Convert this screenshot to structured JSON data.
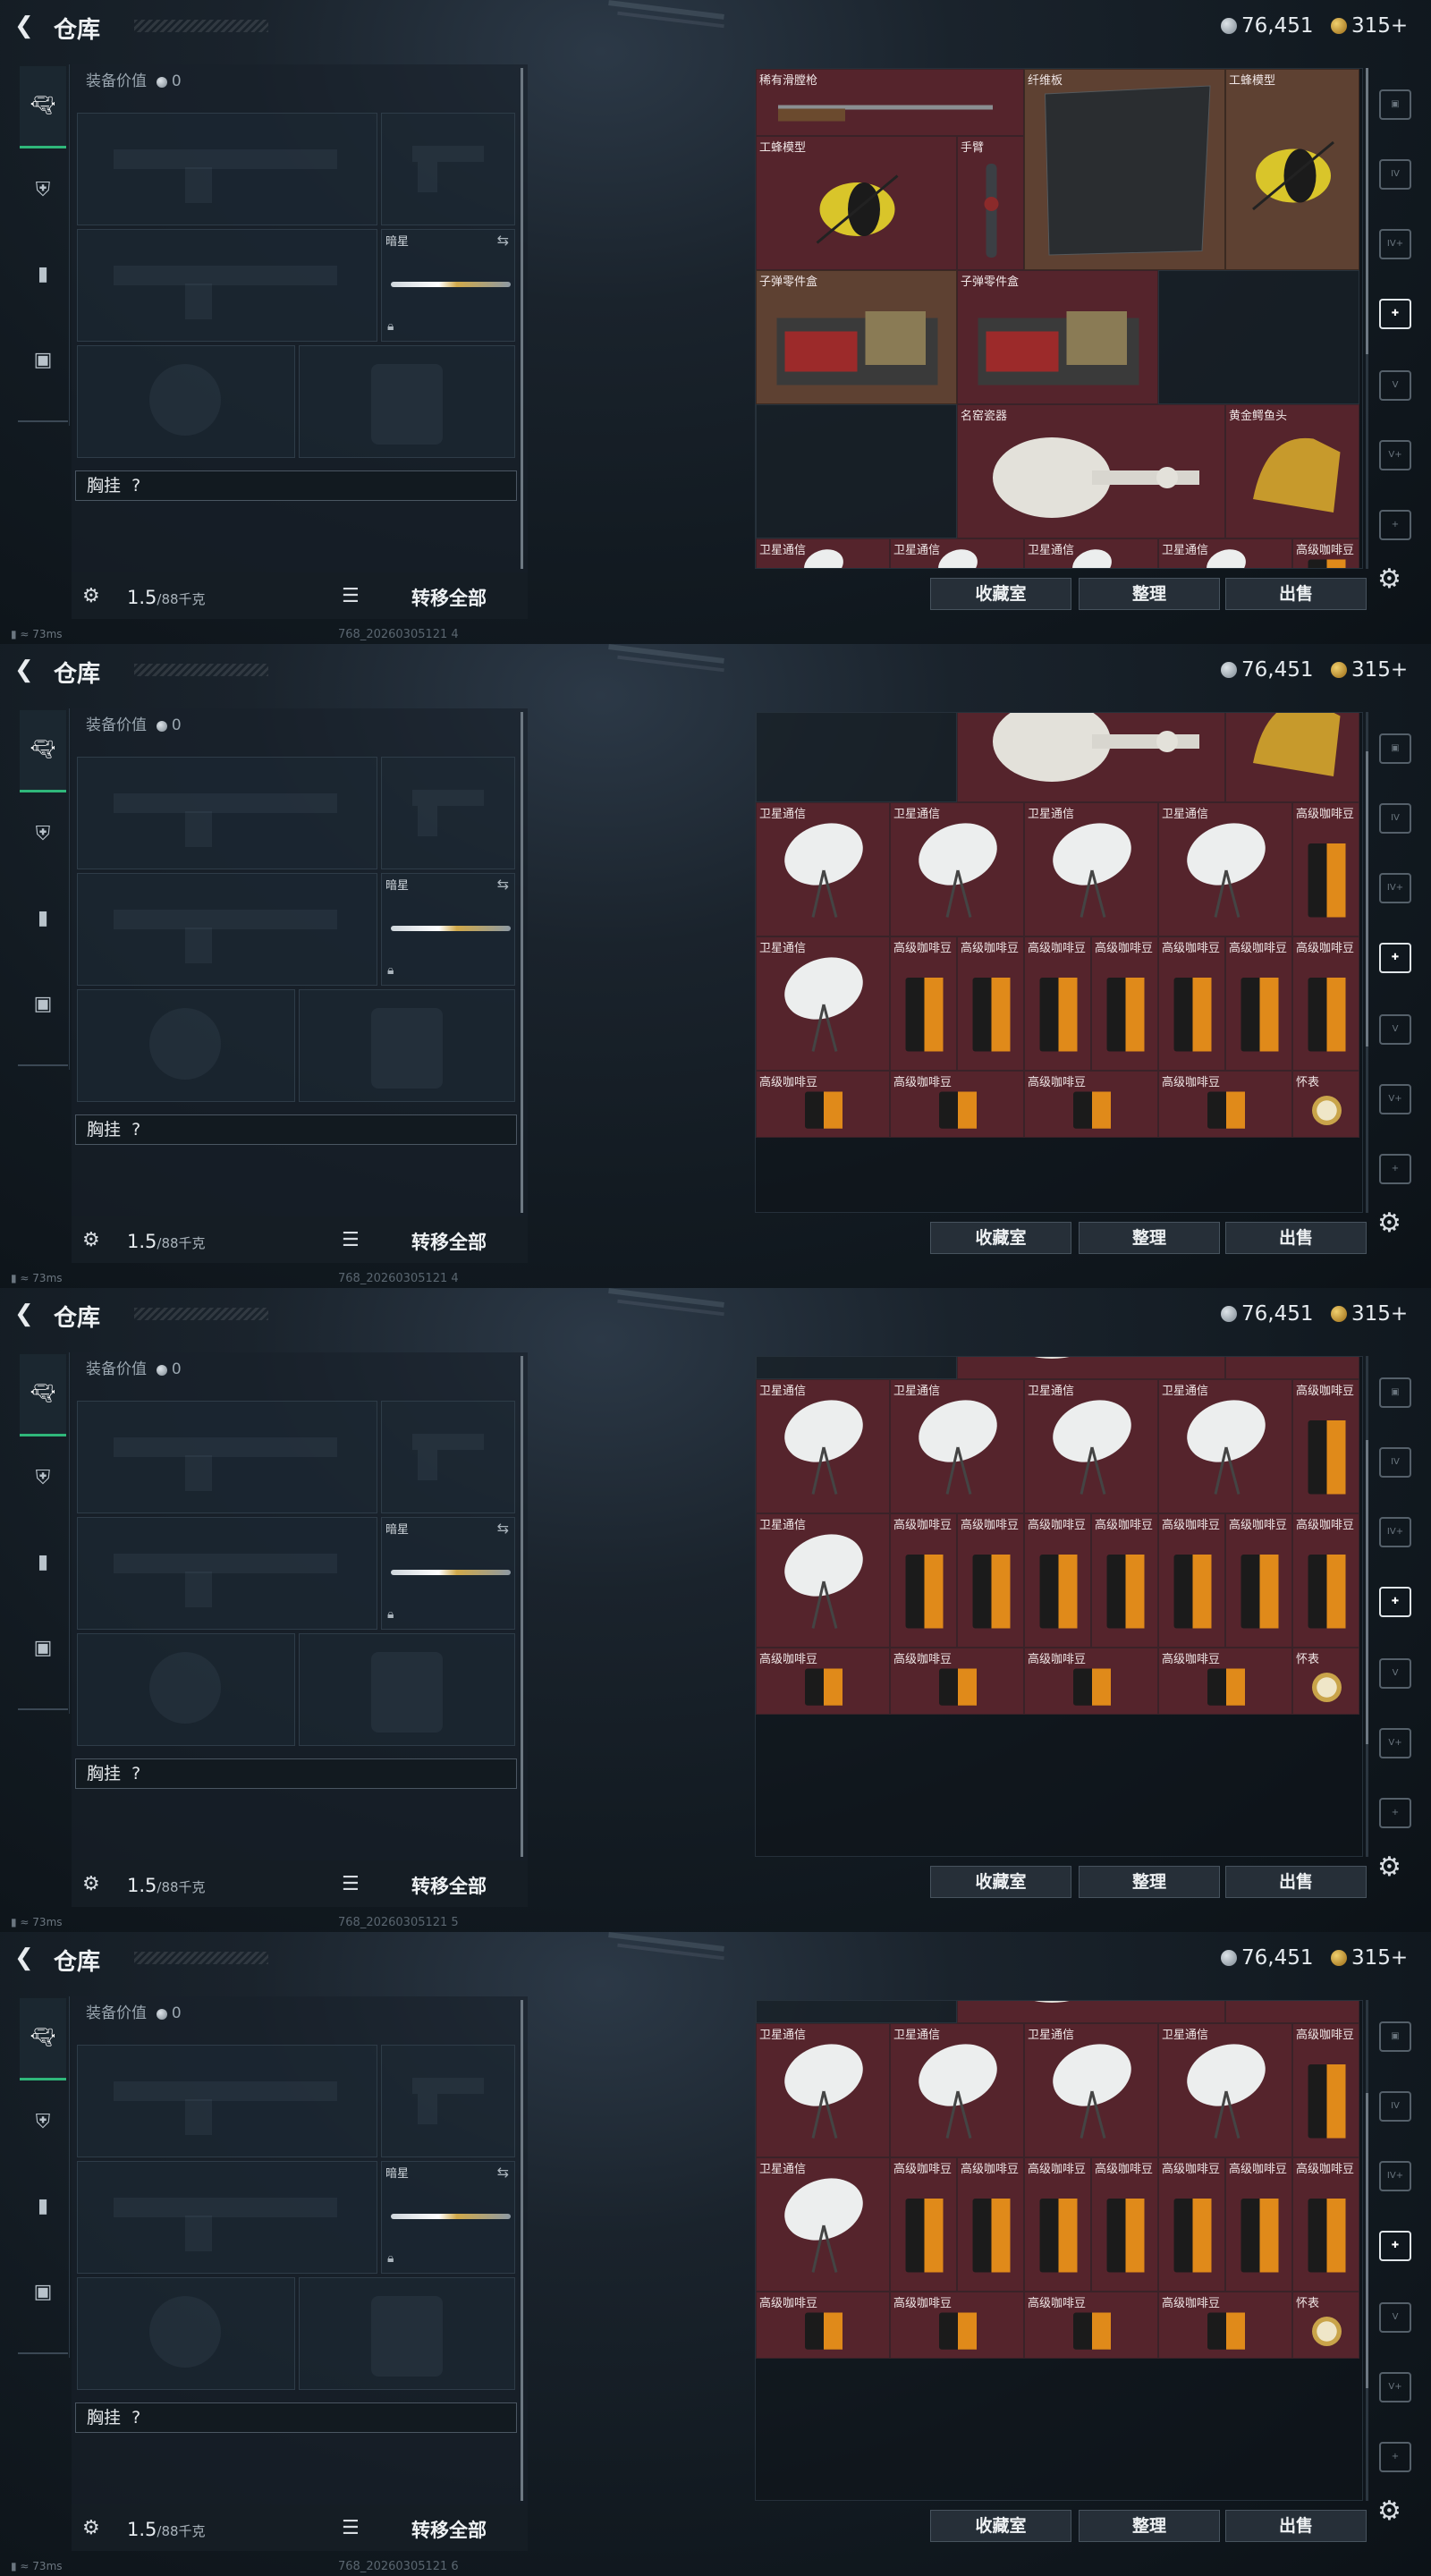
{
  "app": {
    "title": "仓库",
    "back_icon": "back-arrow-icon"
  },
  "currency": {
    "silver": "76,451",
    "gold": "315+",
    "silver_icon": "silver-coin-icon",
    "gold_icon": "gold-coin-icon"
  },
  "tabs": [
    {
      "icon": "pistol-icon",
      "active": true
    },
    {
      "icon": "helmet-icon",
      "active": false
    },
    {
      "icon": "backpack-icon",
      "active": false
    },
    {
      "icon": "case-icon",
      "active": false
    }
  ],
  "loadout": {
    "equipment_value_label": "装备价值",
    "equipment_value": "0",
    "melee_name": "暗星",
    "vest_label": "胸挂",
    "vest_value": "?",
    "weight": "1.5",
    "weight_capacity": "/88千克",
    "transfer_all": "转移全部"
  },
  "buttons": {
    "collection": "收藏室",
    "organize": "整理",
    "sell": "出售"
  },
  "side_icons": [
    "safe-icon",
    "case-iv-icon",
    "case-iv-add-icon",
    "case-add-icon",
    "case-v-icon",
    "case-v-add-icon",
    "case-add-icon-2",
    "case-v-icon-2"
  ],
  "status": {
    "ping": "73ms",
    "id_1": "768_20260305121 4",
    "id_2": "768_20260305121 4",
    "id_3": "768_20260305121 5",
    "id_4": "768_20260305121 6"
  },
  "stash_items": {
    "rifle": "稀有滑膛枪",
    "fiber_board": "纤维板",
    "wasp_model": "工蜂模型",
    "arm": "手臂",
    "bullet_parts": "子弹零件盒",
    "porcelain": "名窑瓷器",
    "gold_crocodile": "黄金鳄鱼头",
    "satellite": "卫星通信",
    "coffee": "高级咖啡豆",
    "pocket_watch": "怀表"
  },
  "colors": {
    "item_bg": "#55242c",
    "accent_green": "#2fb77a"
  }
}
